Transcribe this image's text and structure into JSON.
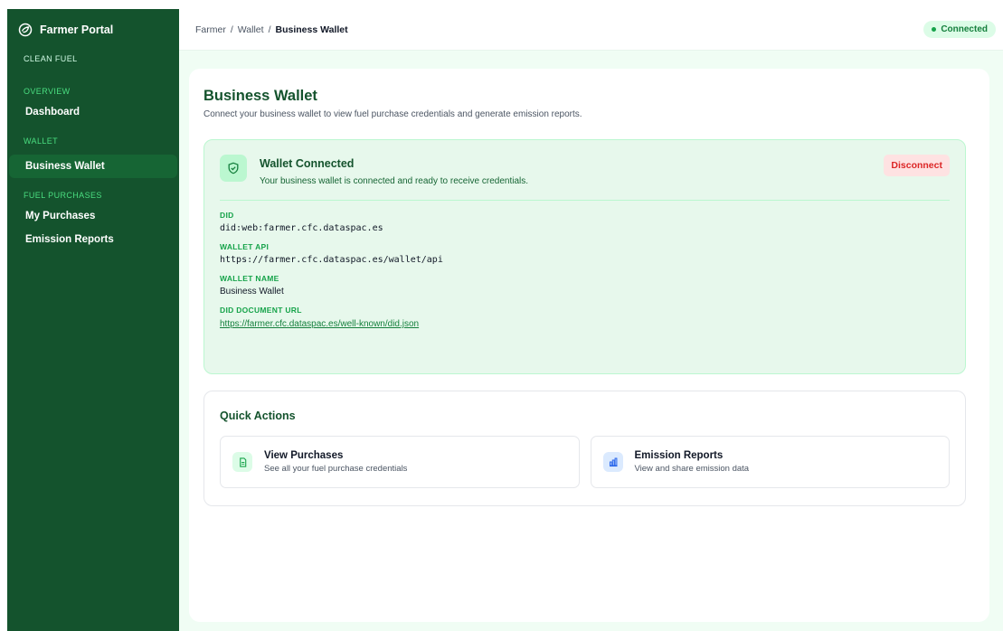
{
  "sidebar": {
    "brand": "Farmer Portal",
    "program": "CLEAN FUEL",
    "sections": [
      {
        "label": "OVERVIEW",
        "items": [
          "Dashboard"
        ]
      },
      {
        "label": "WALLET",
        "items": [
          "Business Wallet"
        ]
      },
      {
        "label": "FUEL PURCHASES",
        "items": [
          "My Purchases",
          "Emission Reports"
        ]
      }
    ],
    "active_item": "Business Wallet"
  },
  "topbar": {
    "breadcrumb": [
      "Farmer",
      "Wallet",
      "Business Wallet"
    ],
    "separator": "/",
    "status": "Connected"
  },
  "page": {
    "title": "Business Wallet",
    "subtitle": "Connect your business wallet to view fuel purchase credentials and generate emission reports."
  },
  "wallet": {
    "title": "Wallet Connected",
    "description": "Your business wallet is connected and ready to receive credentials.",
    "disconnect_label": "Disconnect",
    "fields": {
      "did_label": "DID",
      "did_value": "did:web:farmer.cfc.dataspac.es",
      "api_label": "WALLET API",
      "api_value": "https://farmer.cfc.dataspac.es/wallet/api",
      "name_label": "WALLET NAME",
      "name_value": "Business Wallet",
      "doc_label": "DID DOCUMENT URL",
      "doc_value": "https://farmer.cfc.dataspac.es/well-known/did.json"
    }
  },
  "quick_actions": {
    "title": "Quick Actions",
    "items": [
      {
        "title": "View Purchases",
        "desc": "See all your fuel purchase credentials",
        "icon": "document-icon"
      },
      {
        "title": "Emission Reports",
        "desc": "View and share emission data",
        "icon": "bar-chart-icon"
      }
    ]
  },
  "colors": {
    "sidebar": "#14532d",
    "accent": "#16a34a",
    "danger": "#dc2626"
  }
}
